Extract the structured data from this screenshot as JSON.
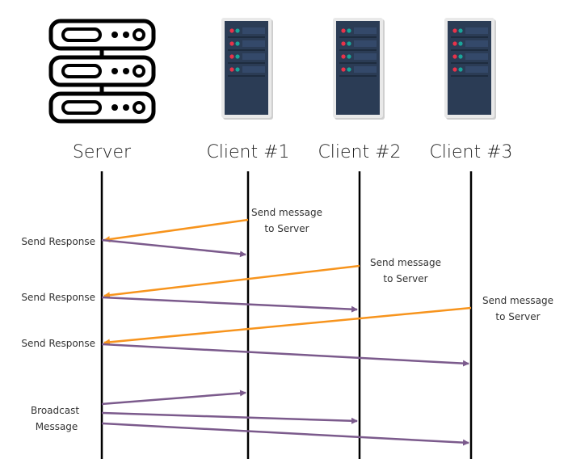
{
  "diagram": {
    "type": "sequence-diagram",
    "colors": {
      "request_arrow": "#f7941d",
      "response_arrow": "#7b5a8c",
      "lifeline": "#000000",
      "rack_body": "#2b3c55",
      "rack_led_red": "#e8334a",
      "rack_led_teal": "#1aa59a"
    },
    "participants": [
      {
        "id": "server",
        "label": "Server",
        "icon": "server-outline-icon"
      },
      {
        "id": "client1",
        "label": "Client #1",
        "icon": "server-rack-icon"
      },
      {
        "id": "client2",
        "label": "Client #2",
        "icon": "server-rack-icon"
      },
      {
        "id": "client3",
        "label": "Client #3",
        "icon": "server-rack-icon"
      }
    ],
    "notes": {
      "send_message": [
        "Send message",
        "to Server"
      ],
      "send_response": "Send Response",
      "broadcast": [
        "Broadcast",
        "Message"
      ]
    },
    "messages": [
      {
        "from": "client1",
        "to": "server",
        "kind": "request",
        "label": "Send message to Server"
      },
      {
        "from": "server",
        "to": "client1",
        "kind": "response",
        "label": "Send Response"
      },
      {
        "from": "client2",
        "to": "server",
        "kind": "request",
        "label": "Send message to Server"
      },
      {
        "from": "server",
        "to": "client2",
        "kind": "response",
        "label": "Send Response"
      },
      {
        "from": "client3",
        "to": "server",
        "kind": "request",
        "label": "Send message to Server"
      },
      {
        "from": "server",
        "to": "client3",
        "kind": "response",
        "label": "Send Response"
      },
      {
        "from": "server",
        "to": "client1",
        "kind": "broadcast",
        "label": "Broadcast Message"
      },
      {
        "from": "server",
        "to": "client2",
        "kind": "broadcast",
        "label": "Broadcast Message"
      },
      {
        "from": "server",
        "to": "client3",
        "kind": "broadcast",
        "label": "Broadcast Message"
      }
    ]
  }
}
